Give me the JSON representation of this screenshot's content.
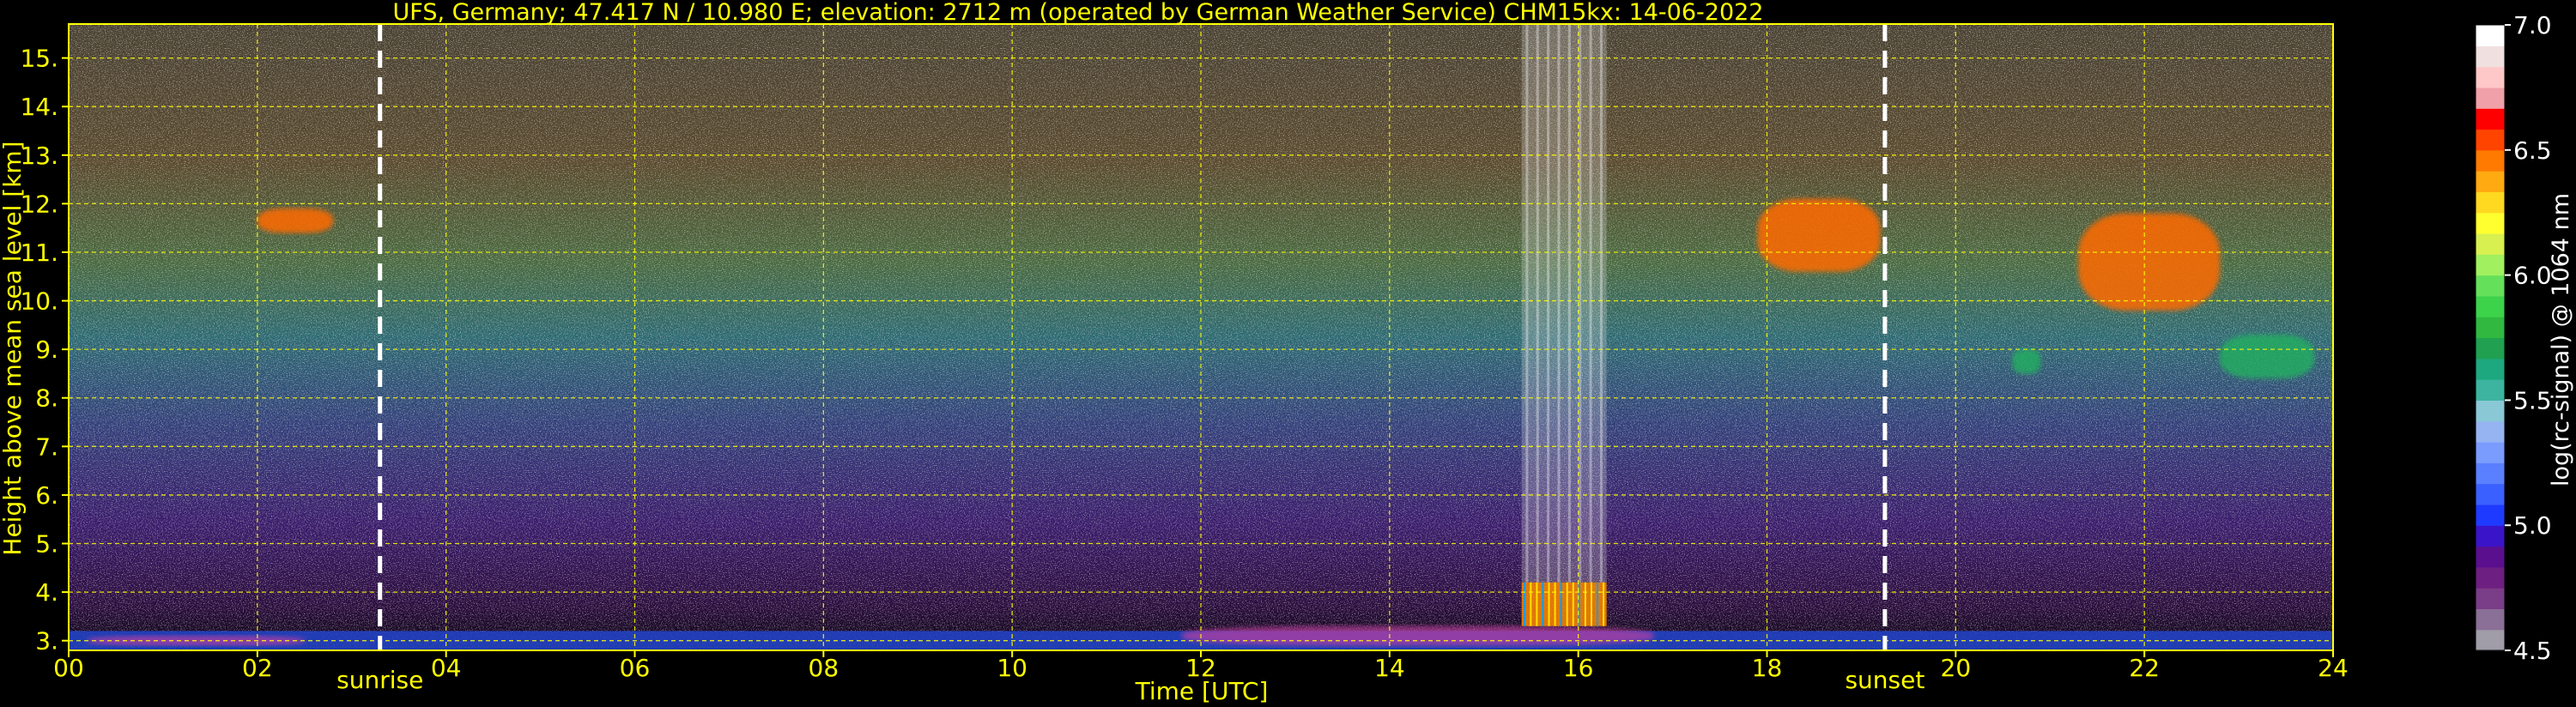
{
  "chart_data": {
    "type": "heatmap",
    "title": "UFS, Germany; 47.417 N / 10.980 E; elevation: 2712 m  (operated by German Weather Service)    CHM15kx: 14-06-2022",
    "xlabel": "Time [UTC]",
    "ylabel": "Height above mean sea level [km]",
    "xlim": [
      0,
      24
    ],
    "ylim": [
      2.8,
      15.7
    ],
    "x_ticks": [
      {
        "value": 0,
        "label": "00"
      },
      {
        "value": 2,
        "label": "02"
      },
      {
        "value": 4,
        "label": "04"
      },
      {
        "value": 6,
        "label": "06"
      },
      {
        "value": 8,
        "label": "08"
      },
      {
        "value": 10,
        "label": "10"
      },
      {
        "value": 12,
        "label": "12"
      },
      {
        "value": 14,
        "label": "14"
      },
      {
        "value": 16,
        "label": "16"
      },
      {
        "value": 18,
        "label": "18"
      },
      {
        "value": 20,
        "label": "20"
      },
      {
        "value": 22,
        "label": "22"
      },
      {
        "value": 24,
        "label": "24"
      }
    ],
    "y_ticks": [
      {
        "value": 3,
        "label": "3."
      },
      {
        "value": 4,
        "label": "4."
      },
      {
        "value": 5,
        "label": "5."
      },
      {
        "value": 6,
        "label": "6."
      },
      {
        "value": 7,
        "label": "7."
      },
      {
        "value": 8,
        "label": "8."
      },
      {
        "value": 9,
        "label": "9."
      },
      {
        "value": 10,
        "label": "10."
      },
      {
        "value": 11,
        "label": "11."
      },
      {
        "value": 12,
        "label": "12."
      },
      {
        "value": 13,
        "label": "13."
      },
      {
        "value": 14,
        "label": "14."
      },
      {
        "value": 15,
        "label": "15."
      }
    ],
    "grid": true,
    "grid_color": "#ffff00",
    "vlines": [
      {
        "x": 3.3,
        "label": "sunrise",
        "color": "#ffffff"
      },
      {
        "x": 19.25,
        "label": "sunset",
        "color": "#ffffff"
      }
    ],
    "features": [
      {
        "kind": "boundary-layer",
        "x": [
          0,
          24
        ],
        "y": [
          2.8,
          3.2
        ]
      },
      {
        "kind": "aerosol-layer",
        "x": [
          0.2,
          2.5
        ],
        "y": [
          2.9,
          3.1
        ]
      },
      {
        "kind": "aerosol-layer",
        "x": [
          11.8,
          16.8
        ],
        "y": [
          2.9,
          3.3
        ]
      },
      {
        "kind": "precipitation-streaks",
        "x": [
          15.4,
          16.3
        ],
        "y": [
          3.3,
          4.2
        ]
      },
      {
        "kind": "noise-columns",
        "x": [
          15.4,
          16.3
        ],
        "y": [
          4.2,
          15.7
        ]
      },
      {
        "kind": "cirrus",
        "x": [
          2.0,
          2.8
        ],
        "y": [
          11.4,
          11.9
        ]
      },
      {
        "kind": "cirrus",
        "x": [
          17.9,
          19.2
        ],
        "y": [
          10.6,
          12.1
        ]
      },
      {
        "kind": "cirrus",
        "x": [
          21.3,
          22.8
        ],
        "y": [
          9.8,
          11.8
        ]
      },
      {
        "kind": "cirrus-fallstreak",
        "x": [
          20.6,
          20.9
        ],
        "y": [
          8.5,
          9.0
        ]
      },
      {
        "kind": "cirrus-fallstreak",
        "x": [
          22.8,
          23.8
        ],
        "y": [
          8.4,
          9.3
        ]
      }
    ],
    "colorbar": {
      "label": "log(rc-signal) @ 1064 nm",
      "range": [
        4.5,
        7.0
      ],
      "ticks": [
        {
          "value": 4.5,
          "label": "4.5"
        },
        {
          "value": 5.0,
          "label": "5.0"
        },
        {
          "value": 5.5,
          "label": "5.5"
        },
        {
          "value": 6.0,
          "label": "6.0"
        },
        {
          "value": 6.5,
          "label": "6.5"
        },
        {
          "value": 7.0,
          "label": "7.0"
        }
      ],
      "colors": [
        "#a09ca8",
        "#8a6f96",
        "#7a3d87",
        "#6e1f82",
        "#5a0f8f",
        "#3a14c8",
        "#1f3aff",
        "#3a60ff",
        "#5a80ff",
        "#7a9cff",
        "#96b4f2",
        "#8ac8d6",
        "#3cb4a0",
        "#1ea880",
        "#20a050",
        "#30b840",
        "#3cd24a",
        "#64e05a",
        "#a0f060",
        "#d8f050",
        "#ffff30",
        "#ffd820",
        "#ffaa10",
        "#ff7a00",
        "#ff4400",
        "#ff0000",
        "#f0a0a8",
        "#ffc8c8",
        "#f0e0e0",
        "#ffffff"
      ]
    }
  }
}
